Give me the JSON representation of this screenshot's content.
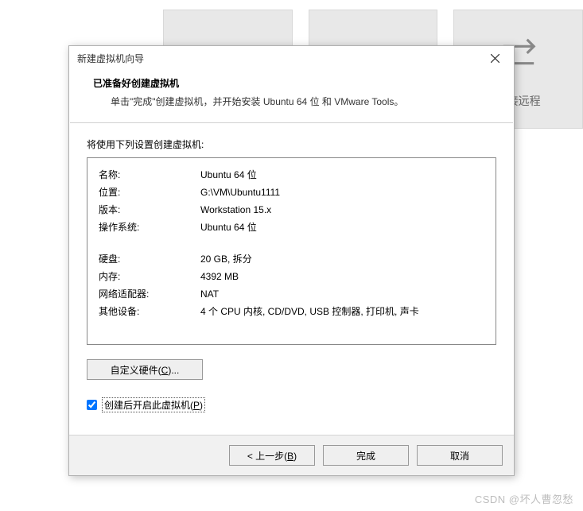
{
  "background": {
    "btn2_label": "",
    "btn3_label": "连接远程"
  },
  "dialog": {
    "title": "新建虚拟机向导",
    "header_title": "已准备好创建虚拟机",
    "header_sub": "单击\"完成\"创建虚拟机，并开始安装 Ubuntu 64 位 和 VMware Tools。",
    "body_label": "将使用下列设置创建虚拟机:",
    "settings": {
      "name_k": "名称:",
      "name_v": "Ubuntu 64 位",
      "loc_k": "位置:",
      "loc_v": "G:\\VM\\Ubuntu1111",
      "ver_k": "版本:",
      "ver_v": "Workstation 15.x",
      "os_k": "操作系统:",
      "os_v": "Ubuntu 64 位",
      "disk_k": "硬盘:",
      "disk_v": "20 GB, 拆分",
      "mem_k": "内存:",
      "mem_v": "4392 MB",
      "net_k": "网络适配器:",
      "net_v": "NAT",
      "other_k": "其他设备:",
      "other_v": "4 个 CPU 内核, CD/DVD, USB 控制器, 打印机, 声卡"
    },
    "custom_hw_pre": "自定义硬件(",
    "custom_hw_key": "C",
    "custom_hw_post": ")...",
    "power_on_pre": "创建后开启此虚拟机(",
    "power_on_key": "P",
    "power_on_post": ")",
    "footer": {
      "back_pre": "< 上一步(",
      "back_key": "B",
      "back_post": ")",
      "finish": "完成",
      "cancel": "取消"
    }
  },
  "watermark": "CSDN @坏人曹忽愁"
}
